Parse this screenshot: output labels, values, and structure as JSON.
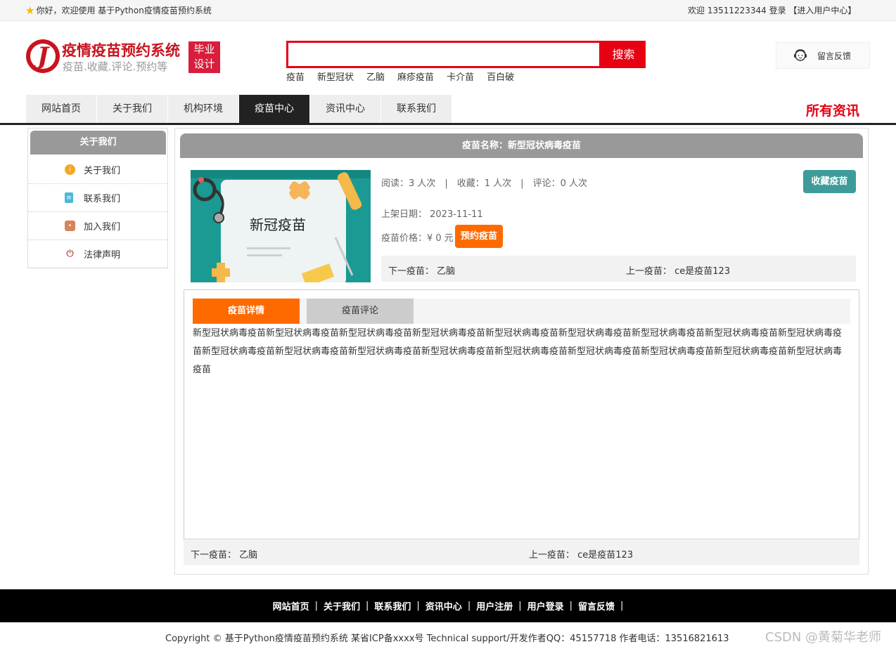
{
  "topbar": {
    "welcome": "你好，欢迎使用 基于Python疫情疫苗预约系统",
    "right": "欢迎 13511223344 登录 【进入用户中心】"
  },
  "header": {
    "logo_title": "疫情疫苗预约系统",
    "logo_sub": "疫苗.收藏.评论.预约等",
    "badge_line1": "毕业",
    "badge_line2": "设计",
    "search": {
      "value": "",
      "button": "搜索"
    },
    "hotwords": [
      "疫苗",
      "新型冠状",
      "乙脑",
      "麻疹疫苗",
      "卡介苗",
      "百白破"
    ],
    "feedback": "留言反馈"
  },
  "nav": {
    "items": [
      "网站首页",
      "关于我们",
      "机构环境",
      "疫苗中心",
      "资讯中心",
      "联系我们"
    ],
    "active_index": 3,
    "all_news": "所有资讯"
  },
  "sidebar": {
    "title": "关于我们",
    "links": [
      {
        "label": "关于我们",
        "icon": "info-icon",
        "color": "#f5a623"
      },
      {
        "label": "联系我们",
        "icon": "clipboard-icon",
        "color": "#4ab8d8"
      },
      {
        "label": "加入我们",
        "icon": "lock-icon",
        "color": "#d8845a"
      },
      {
        "label": "法律声明",
        "icon": "power-icon",
        "color": "#c45a5a"
      }
    ]
  },
  "detail": {
    "heading": "疫苗名称：新型冠状病毒疫苗",
    "image_text": "新冠疫苗",
    "stats": "阅读：3 人次　|　收藏：1 人次　|　评论：0 人次",
    "collect_button": "收藏疫苗",
    "date": "上架日期：  2023-11-11",
    "price": "疫苗价格：¥ 0 元",
    "book_button": "预约疫苗",
    "next": "下一疫苗：  乙脑",
    "prev": "上一疫苗：  ce是疫苗123",
    "tabs": [
      "疫苗详情",
      "疫苗评论"
    ],
    "body": "新型冠状病毒疫苗新型冠状病毒疫苗新型冠状病毒疫苗新型冠状病毒疫苗新型冠状病毒疫苗新型冠状病毒疫苗新型冠状病毒疫苗新型冠状病毒疫苗新型冠状病毒疫苗新型冠状病毒疫苗新型冠状病毒疫苗新型冠状病毒疫苗新型冠状病毒疫苗新型冠状病毒疫苗新型冠状病毒疫苗新型冠状病毒疫苗新型冠状病毒疫苗新型冠状病毒疫苗"
  },
  "footer": {
    "links": [
      "网站首页",
      "关于我们",
      "联系我们",
      "资讯中心",
      "用户注册",
      "用户登录",
      "留言反馈"
    ],
    "copyright": "Copyright © 基于Python疫情疫苗预约系统 某省ICP备xxxx号    Technical support/开发作者QQ：45157718     作者电话：13516821613",
    "watermark": "CSDN @黄菊华老师"
  },
  "colors": {
    "brand_red": "#e60012",
    "accent_orange": "#ff6a00",
    "teal": "#3d9c9a"
  }
}
